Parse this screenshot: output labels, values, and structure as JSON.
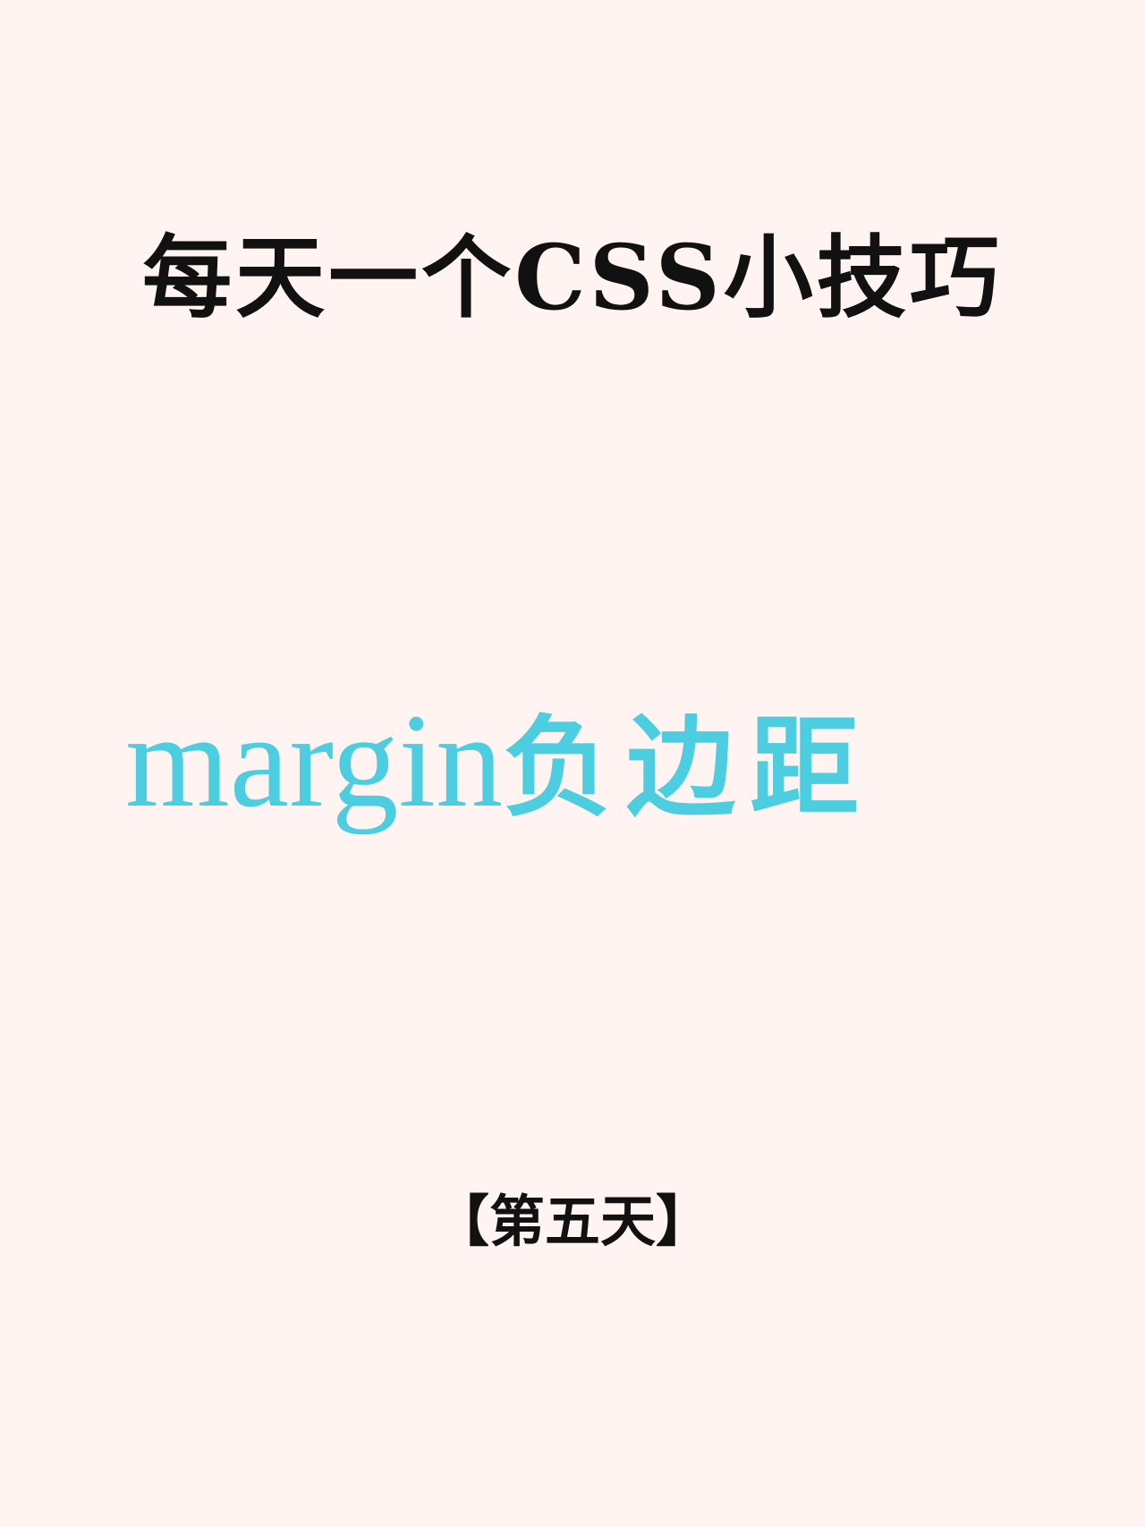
{
  "colors": {
    "background": "#fff4f2",
    "title_text": "#111111",
    "accent": "#4dcde0"
  },
  "header": {
    "title": "每天一个CSS小技巧"
  },
  "topic": {
    "latin": "margin",
    "chinese": "负边距"
  },
  "footer": {
    "day": "【第五天】"
  }
}
